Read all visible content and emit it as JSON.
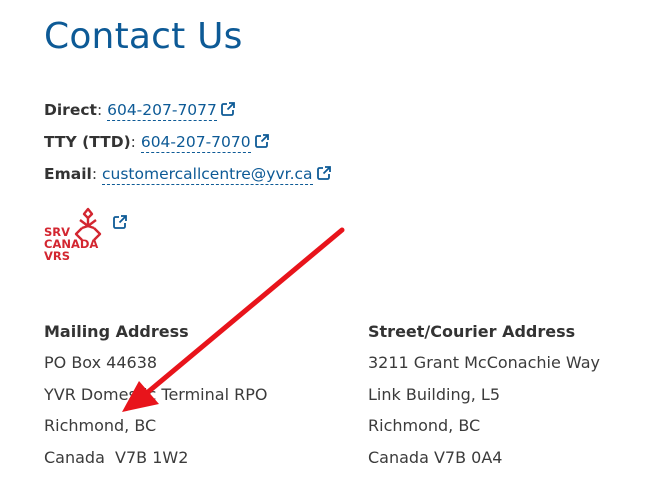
{
  "page": {
    "title": "Contact Us"
  },
  "contact": {
    "direct": {
      "label": "Direct",
      "value": "604-207-7077"
    },
    "tty": {
      "label": "TTY (TTD)",
      "value": "604-207-7070"
    },
    "email": {
      "label": "Email",
      "value": "customercallcentre@yvr.ca"
    },
    "link_color": "#0d5a96"
  },
  "srv_logo": {
    "icon": "srv-canada-vrs-logo",
    "lines": [
      "SRV",
      "CANADA",
      "VRS"
    ],
    "color": "#d32630"
  },
  "mailing": {
    "heading": "Mailing Address",
    "lines": [
      "PO Box 44638",
      "YVR Domestic Terminal RPO",
      "Richmond, BC",
      "Canada  V7B 1W2"
    ]
  },
  "street": {
    "heading": "Street/Courier Address",
    "lines": [
      "3211 Grant McConachie Way",
      "Link Building, L5",
      "Richmond, BC",
      "Canada V7B 0A4"
    ]
  },
  "annotation": {
    "icon": "red-arrow",
    "color": "#e8141b"
  },
  "colors": {
    "title": "#0d5a96",
    "text": "#3b3b3b"
  }
}
